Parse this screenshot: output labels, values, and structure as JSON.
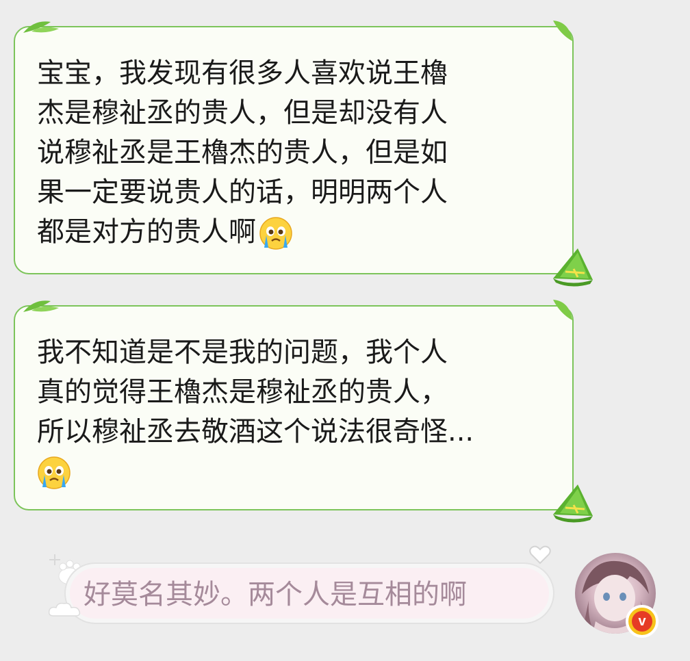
{
  "messages": [
    {
      "side": "left",
      "lines": [
        "宝宝，我发现有很多人喜欢说王櫓",
        "杰是穆祉丞的贵人，但是却没有人",
        "说穆祉丞是王櫓杰的贵人，但是如",
        "果一定要说贵人的话，明明两个人",
        "都是对方的贵人啊"
      ],
      "emoji": "crying-face"
    },
    {
      "side": "left",
      "lines": [
        "我不知道是不是我的问题，我个人",
        "真的觉得王櫓杰是穆祉丞的贵人，",
        "所以穆祉丞去敬酒这个说法很奇怪..."
      ],
      "emoji": "crying-face"
    },
    {
      "side": "right",
      "text": "好莫名其妙。两个人是互相的啊"
    }
  ],
  "colors": {
    "background": "#ededed",
    "left_bubble_fill": "#fbfdf6",
    "left_bubble_border": "#7cc45a",
    "right_bubble_fill": "#fbeff3",
    "right_text": "#a58a9a",
    "vip_badge": "#e63b25"
  },
  "avatar": {
    "badge_text": "v"
  }
}
